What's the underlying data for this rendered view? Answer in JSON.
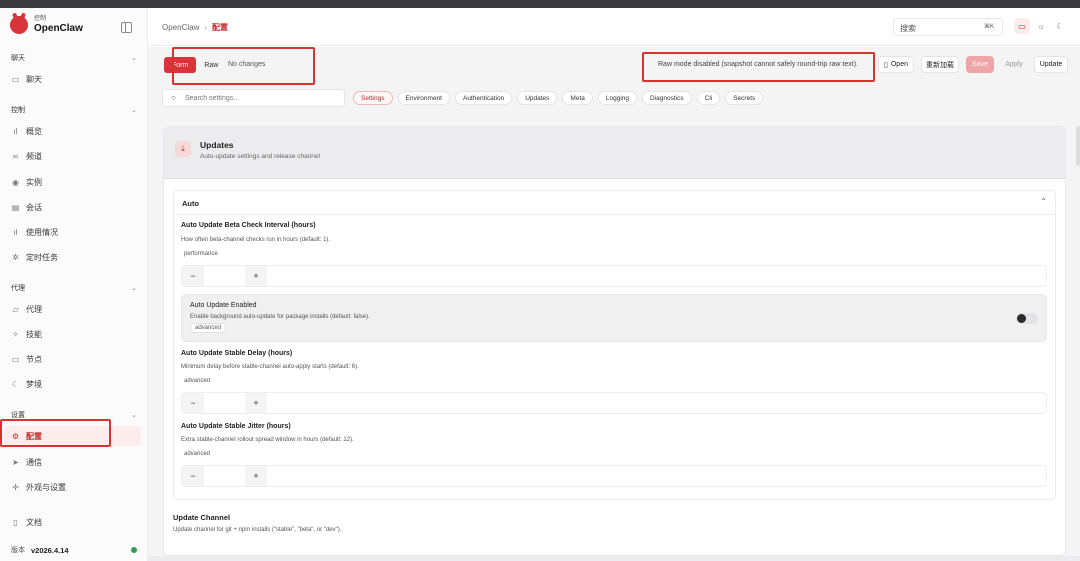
{
  "brand": {
    "sub": "控制",
    "name": "OpenClaw"
  },
  "sidebar": {
    "sections": [
      {
        "title": "聊天",
        "items": [
          {
            "label": "聊天",
            "icon": "chat-icon"
          }
        ]
      },
      {
        "title": "控制",
        "items": [
          {
            "label": "概览",
            "icon": "bar-chart-icon"
          },
          {
            "label": "频道",
            "icon": "link-icon"
          },
          {
            "label": "实例",
            "icon": "radio-icon"
          },
          {
            "label": "会话",
            "icon": "document-icon"
          },
          {
            "label": "使用情况",
            "icon": "bar-chart-icon"
          },
          {
            "label": "定时任务",
            "icon": "loader-icon"
          }
        ]
      },
      {
        "title": "代理",
        "items": [
          {
            "label": "代理",
            "icon": "folder-icon"
          },
          {
            "label": "技能",
            "icon": "sparkle-icon"
          },
          {
            "label": "节点",
            "icon": "monitor-icon"
          },
          {
            "label": "梦境",
            "icon": "moon-icon"
          }
        ]
      },
      {
        "title": "设置",
        "items": [
          {
            "label": "配置",
            "icon": "gear-icon",
            "active": true
          },
          {
            "label": "通信",
            "icon": "send-icon"
          },
          {
            "label": "外观与设置",
            "icon": "plus-icon"
          }
        ]
      }
    ],
    "docs": {
      "label": "文档",
      "icon": "book-icon"
    },
    "version": {
      "label": "版本",
      "value": "v2026.4.14"
    }
  },
  "header": {
    "breadcrumb_root": "OpenClaw",
    "breadcrumb_sep": "›",
    "breadcrumb_current": "配置",
    "search_label": "搜索",
    "search_shortcut": "⌘K"
  },
  "toolbar": {
    "mode_form": "Form",
    "mode_raw": "Raw",
    "status": "No changes",
    "raw_message": "Raw mode disabled (snapshot cannot safely round-trip raw text).",
    "open": "Open",
    "reload": "重新加载",
    "save": "Save",
    "apply": "Apply",
    "update": "Update"
  },
  "filters": {
    "search_placeholder": "Search settings...",
    "chips": [
      "Settings",
      "Environment",
      "Authentication",
      "Updates",
      "Meta",
      "Logging",
      "Diagnostics",
      "Cli",
      "Secrets"
    ],
    "active": "Settings"
  },
  "panel": {
    "title": "Updates",
    "subtitle": "Auto-update settings and release channel",
    "group": {
      "title": "Auto",
      "fields": {
        "beta_interval": {
          "title": "Auto Update Beta Check Interval (hours)",
          "desc": "How often beta-channel checks run in hours (default: 1).",
          "tag": "performance"
        },
        "enabled": {
          "title": "Auto Update Enabled",
          "desc": "Enable background auto-update for package installs (default: false).",
          "tag": "advanced",
          "value": false
        },
        "stable_delay": {
          "title": "Auto Update Stable Delay (hours)",
          "desc": "Minimum delay before stable-channel auto-apply starts (default: 6).",
          "tag": "advanced"
        },
        "stable_jitter": {
          "title": "Auto Update Stable Jitter (hours)",
          "desc": "Extra stable-channel rollout spread window in hours (default: 12).",
          "tag": "advanced"
        }
      }
    },
    "update_channel": {
      "title": "Update Channel",
      "desc": "Update channel for git + npm installs (\"stable\", \"beta\", or \"dev\")."
    }
  },
  "stepper": {
    "minus": "−",
    "plus": "+"
  },
  "colors": {
    "accent": "#d8343a",
    "highlight": "#d9322f",
    "status_ok": "#2e9e4f"
  }
}
